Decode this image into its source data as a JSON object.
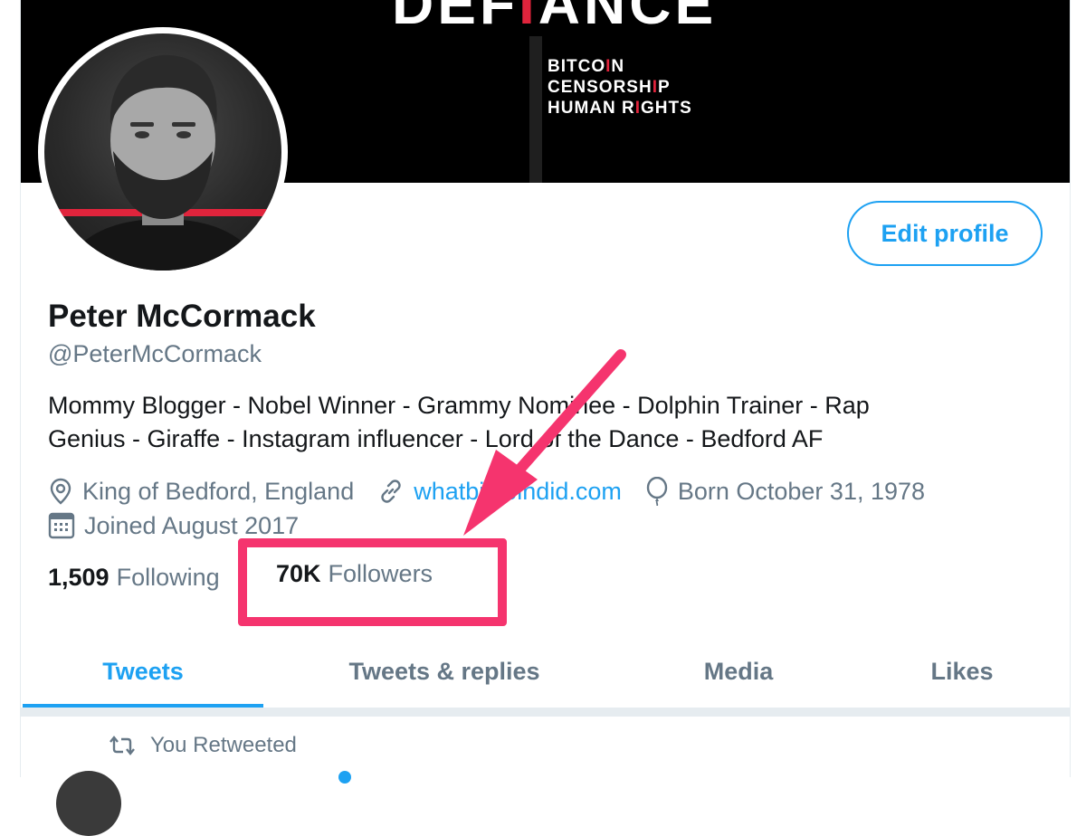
{
  "banner": {
    "title_pre": "DEF",
    "title_red": "I",
    "title_post": "ANCE",
    "topics": [
      {
        "pre": "BITCO",
        "red": "I",
        "post": "N"
      },
      {
        "pre": "CENSORSH",
        "red": "I",
        "post": "P"
      },
      {
        "pre": "HUMAN R",
        "red": "I",
        "post": "GHTS"
      }
    ]
  },
  "profile": {
    "edit_button": "Edit profile",
    "name": "Peter McCormack",
    "handle": "@PeterMcCormack",
    "bio_lines": [
      "Mommy Blogger - Nobel Winner - Grammy Nominee - Dolphin Trainer - Rap",
      "Genius - Giraffe - Instagram influencer - Lord of the Dance - Bedford AF"
    ],
    "location": "King of Bedford, England",
    "website": "whatbitcoindid.com",
    "birthday": "Born October 31, 1978",
    "joined": "Joined August 2017"
  },
  "stats": {
    "following_count": "1,509",
    "following_label": "Following",
    "followers_count": "70K",
    "followers_label": "Followers"
  },
  "tabs": [
    "Tweets",
    "Tweets & replies",
    "Media",
    "Likes"
  ],
  "feed": {
    "retweet_label": "You Retweeted"
  },
  "colors": {
    "accent": "#1da1f2",
    "annotation": "#f5346e",
    "banner_red": "#e0243c",
    "muted_text": "#657786"
  },
  "icons": [
    "location-pin-icon",
    "link-icon",
    "balloon-icon",
    "calendar-icon",
    "retweet-icon"
  ]
}
